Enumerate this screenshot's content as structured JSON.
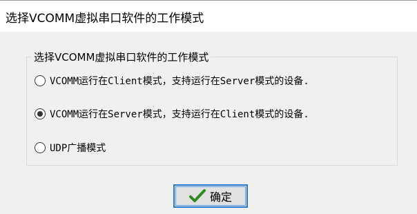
{
  "window": {
    "title": "选择VCOMM虚拟串口软件的工作模式"
  },
  "group": {
    "legend": "选择VCOMM虚拟串口软件的工作模式",
    "options": [
      {
        "label": "VCOMM运行在Client模式，支持运行在Server模式的设备.",
        "checked": false
      },
      {
        "label": "VCOMM运行在Server模式，支持运行在Client模式的设备.",
        "checked": true
      },
      {
        "label": "UDP广播模式",
        "checked": false
      }
    ]
  },
  "ok_button": {
    "label": "确定",
    "icon": "check-icon",
    "icon_color": "#2e8b1f"
  },
  "colors": {
    "focus_border": "#2a7ad4",
    "background": "#f0f0f0"
  }
}
